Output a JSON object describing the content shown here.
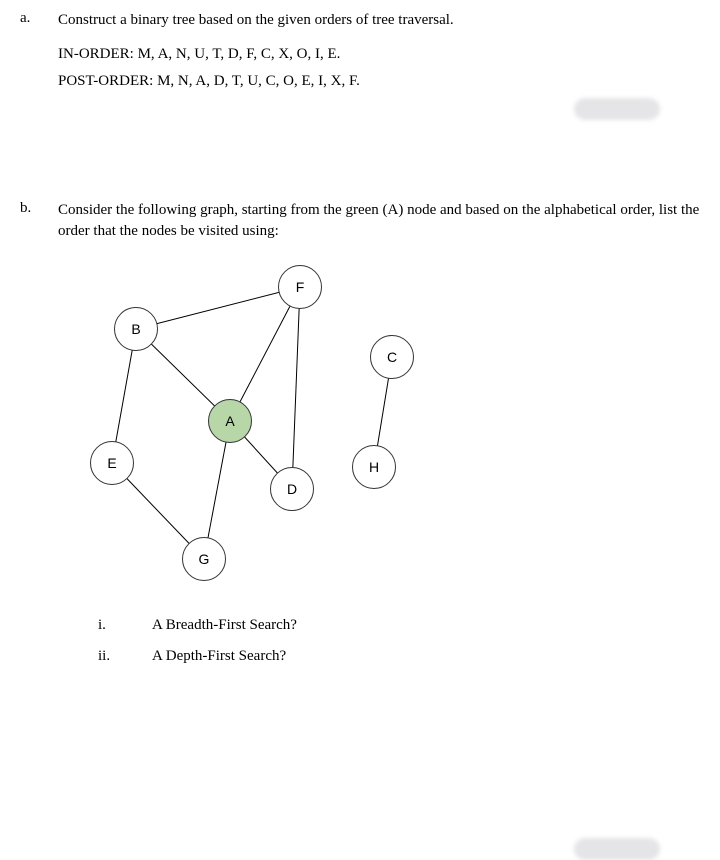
{
  "q_a": {
    "marker": "a.",
    "prompt": "Construct a binary tree based on the given orders of tree traversal.",
    "in_order_label": "IN-ORDER:",
    "in_order_values": "M, A, N, U, T, D, F, C, X, O, I, E.",
    "post_order_label": "POST-ORDER:",
    "post_order_values": "M, N, A, D, T, U, C, O, E, I, X, F."
  },
  "q_b": {
    "marker": "b.",
    "prompt": "Consider the following graph, starting from the green (A) node and based on the alphabetical order, list the order that the nodes be visited using:",
    "sub_i_marker": "i.",
    "sub_i_text": "A Breadth-First Search?",
    "sub_ii_marker": "ii.",
    "sub_ii_text": "A Depth-First Search?"
  },
  "graph": {
    "nodes": {
      "A": "A",
      "B": "B",
      "C": "C",
      "D": "D",
      "E": "E",
      "F": "F",
      "G": "G",
      "H": "H"
    },
    "start_node": "A",
    "edges": [
      [
        "B",
        "F"
      ],
      [
        "B",
        "A"
      ],
      [
        "B",
        "E"
      ],
      [
        "A",
        "D"
      ],
      [
        "A",
        "F"
      ],
      [
        "A",
        "G"
      ],
      [
        "E",
        "G"
      ],
      [
        "F",
        "D"
      ],
      [
        "C",
        "H"
      ]
    ]
  }
}
